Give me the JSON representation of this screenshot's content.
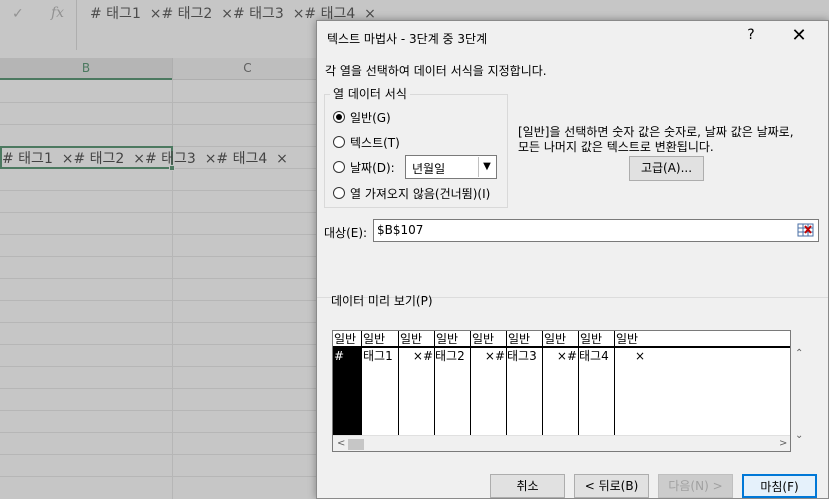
{
  "formula_bar": {
    "cancel_icon": "check-icon",
    "fx_label": "fx",
    "content": "# 태그1  ×# 태그2  ×# 태그3  ×# 태그4  ×"
  },
  "sheet": {
    "columns": [
      "B",
      "C"
    ],
    "active_cell_text": "# 태그1  ×# 태그2  ×# 태그3  ×# 태그4  ×"
  },
  "dialog": {
    "title": "텍스트 마법사 - 3단계 중 3단계",
    "help_label": "?",
    "close_label": "✕",
    "instruction": "각 열을 선택하여 데이터 서식을 지정합니다.",
    "format_group": {
      "title": "열 데이터 서식",
      "options": [
        {
          "label": "일반(G)",
          "checked": true
        },
        {
          "label": "텍스트(T)",
          "checked": false
        },
        {
          "label": "날짜(D):",
          "checked": false
        },
        {
          "label": "열 가져오지 않음(건너뜀)(I)",
          "checked": false
        }
      ],
      "date_format": "년월일"
    },
    "description": [
      "[일반]을 선택하면 숫자 값은 숫자로, 날짜 값은 날짜로,",
      "모든 나머지 값은 텍스트로 변환됩니다."
    ],
    "advanced_button": "고급(A)...",
    "destination_label": "대상(E):",
    "destination_value": "$B$107",
    "preview_label": "데이터 미리 보기(P)",
    "preview": {
      "headers": [
        "일반",
        "일반",
        "일반",
        "일반",
        "일반",
        "일반",
        "일반",
        "일반",
        "일반"
      ],
      "cells": [
        "#",
        "태그1",
        "×#",
        "태그2",
        "×#",
        "태그3",
        "×#",
        "태그4",
        "×"
      ]
    },
    "buttons": {
      "cancel": "취소",
      "back": "< 뒤로(B)",
      "next": "다음(N) >",
      "finish": "마침(F)"
    }
  }
}
